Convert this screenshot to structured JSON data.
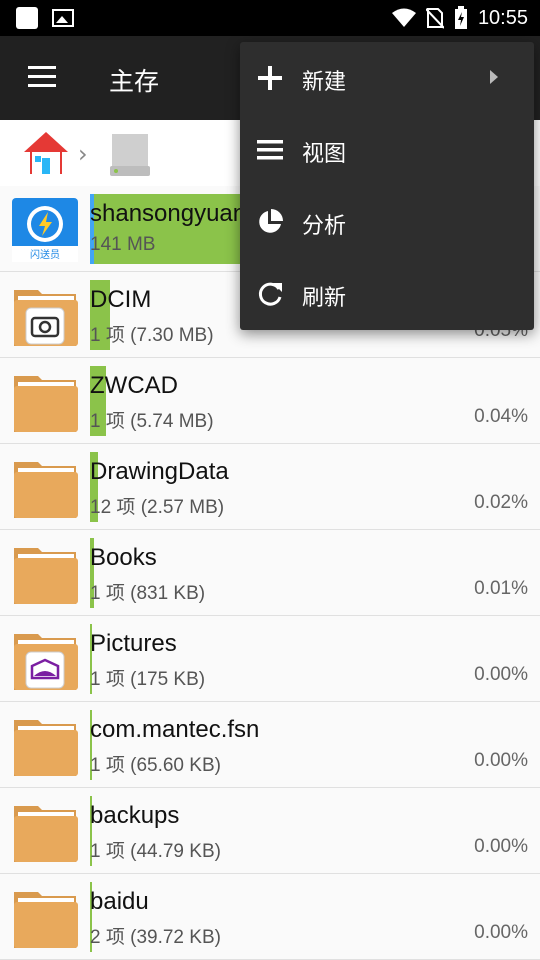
{
  "status_bar": {
    "time": "10:55"
  },
  "app_bar": {
    "title": "主存"
  },
  "files": [
    {
      "name": "shansongyuan",
      "meta": "141 MB",
      "pct": "",
      "fill": 0.95,
      "icon": "app-shansong-icon",
      "thumb_label": "闪送员"
    },
    {
      "name": "DCIM",
      "meta": "1 项 (7.30 MB)",
      "pct": "0.05%",
      "fill": 0.05,
      "icon": "camera-folder-icon"
    },
    {
      "name": "ZWCAD",
      "meta": "1 项 (5.74 MB)",
      "pct": "0.04%",
      "fill": 0.04,
      "icon": "folder-icon"
    },
    {
      "name": "DrawingData",
      "meta": "12 项 (2.57 MB)",
      "pct": "0.02%",
      "fill": 0.02,
      "icon": "folder-icon"
    },
    {
      "name": "Books",
      "meta": "1 项 (831 KB)",
      "pct": "0.01%",
      "fill": 0.01,
      "icon": "folder-icon"
    },
    {
      "name": "Pictures",
      "meta": "1 项 (175 KB)",
      "pct": "0.00%",
      "fill": 0.0,
      "icon": "pictures-folder-icon"
    },
    {
      "name": "com.mantec.fsn",
      "meta": "1 项 (65.60 KB)",
      "pct": "0.00%",
      "fill": 0.0,
      "icon": "folder-icon"
    },
    {
      "name": "backups",
      "meta": "1 项 (44.79 KB)",
      "pct": "0.00%",
      "fill": 0.0,
      "icon": "folder-icon"
    },
    {
      "name": "baidu",
      "meta": "2 项 (39.72 KB)",
      "pct": "0.00%",
      "fill": 0.0,
      "icon": "folder-icon"
    }
  ],
  "popup_menu": {
    "items": [
      {
        "label": "新建",
        "icon": "plus-icon",
        "submenu": true
      },
      {
        "label": "视图",
        "icon": "list-view-icon",
        "submenu": false
      },
      {
        "label": "分析",
        "icon": "pie-chart-icon",
        "submenu": false
      },
      {
        "label": "刷新",
        "icon": "refresh-icon",
        "submenu": false
      }
    ]
  },
  "colors": {
    "usage_bar": "#8bc34a",
    "folder": "#e8a95c",
    "appbar": "#212121",
    "menu_bg": "#2e2e2e"
  }
}
